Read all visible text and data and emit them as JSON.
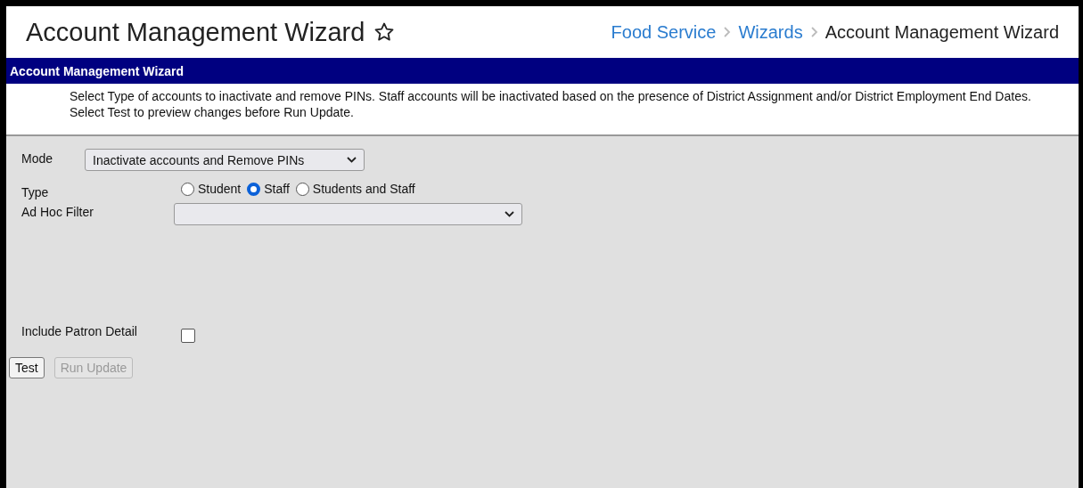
{
  "header": {
    "title": "Account Management Wizard",
    "favorite": false,
    "breadcrumbs": [
      {
        "label": "Food Service",
        "link": true
      },
      {
        "label": "Wizards",
        "link": true
      },
      {
        "label": "Account Management Wizard",
        "link": false
      }
    ]
  },
  "panel": {
    "title": "Account Management Wizard",
    "description": [
      "Select Type of accounts to inactivate and remove PINs. Staff accounts will be inactivated based on the presence of District Assignment and/or District Employment End Dates.",
      "Select Test to preview changes before Run Update."
    ]
  },
  "form": {
    "mode": {
      "label": "Mode",
      "value": "Inactivate accounts and Remove PINs"
    },
    "type": {
      "label": "Type",
      "options": [
        {
          "label": "Student",
          "selected": false
        },
        {
          "label": "Staff",
          "selected": true
        },
        {
          "label": "Students and Staff",
          "selected": false
        }
      ]
    },
    "ad_hoc_filter": {
      "label": "Ad Hoc Filter"
    },
    "include_patron_detail": {
      "label": "Include Patron Detail",
      "checked": false
    }
  },
  "buttons": [
    {
      "label": "Test",
      "disabled": false
    },
    {
      "label": "Run Update",
      "disabled": true
    }
  ]
}
